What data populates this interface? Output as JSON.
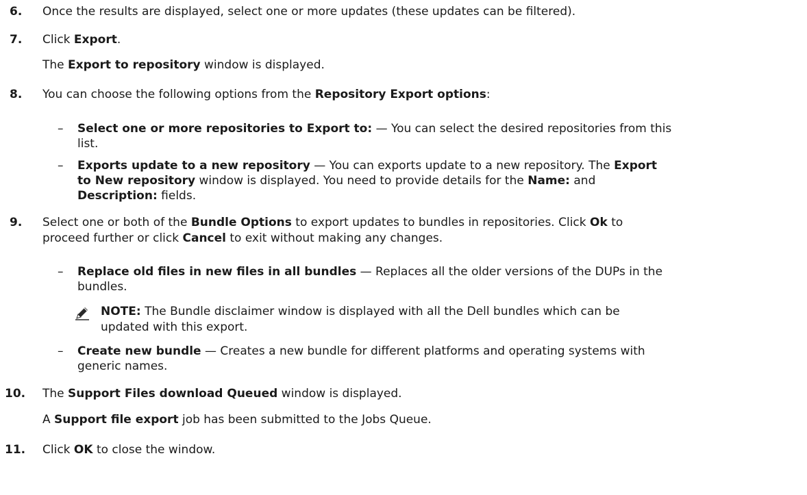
{
  "steps": [
    {
      "number": "6.",
      "parts": [
        "Once the results are displayed, select one or more updates (these updates can be filtered)."
      ]
    },
    {
      "number": "7.",
      "parts": [
        "Click ",
        "Export",
        "."
      ]
    },
    {
      "sub": [
        "The ",
        "Export to repository",
        " window is displayed."
      ]
    },
    {
      "number": "8.",
      "parts": [
        "You can choose the following options from the ",
        "Repository Export options",
        ":"
      ]
    },
    {
      "bullet1": {
        "bold": "Select one or more repositories to Export to:",
        "text": " — You can select the desired repositories from this",
        "cont": "list."
      }
    },
    {
      "bullet2": {
        "bold": "Exports update to a new repository",
        "text": " — You can exports update to a new repository. The ",
        "bold2": "Export",
        "line2_bold": "to New repository",
        "line2_text": " window is displayed. You need to provide details for the ",
        "line2_bold2": "Name:",
        "line2_text2": " and",
        "line3_bold": "Description:",
        "line3_text": " fields."
      }
    },
    {
      "number": "9.",
      "parts": [
        "Select one or both of the ",
        "Bundle Options",
        " to export updates to bundles in repositories. Click ",
        "Ok",
        " to"
      ],
      "cont": [
        "proceed further or click ",
        "Cancel",
        " to exit without making any changes."
      ]
    },
    {
      "bullet3": {
        "bold": "Replace old files in new files in all bundles",
        "text": " — Replaces all the older versions of the DUPs in the",
        "cont": "bundles."
      }
    },
    {
      "note": {
        "label": "NOTE:",
        "text": " The Bundle disclaimer window is displayed with all the Dell bundles which can be",
        "cont": "updated with this export."
      }
    },
    {
      "bullet4": {
        "bold": "Create new bundle",
        "text": " — Creates a new bundle for different platforms and operating systems with",
        "cont": "generic names."
      }
    },
    {
      "number": "10.",
      "parts": [
        "The ",
        "Support Files download Queued",
        " window is displayed."
      ]
    },
    {
      "sub": [
        "A ",
        "Support file export",
        " job has been submitted to the Jobs Queue."
      ]
    },
    {
      "number": "11.",
      "parts": [
        "Click ",
        "OK",
        " to close the window."
      ]
    }
  ],
  "dash_char": "–"
}
